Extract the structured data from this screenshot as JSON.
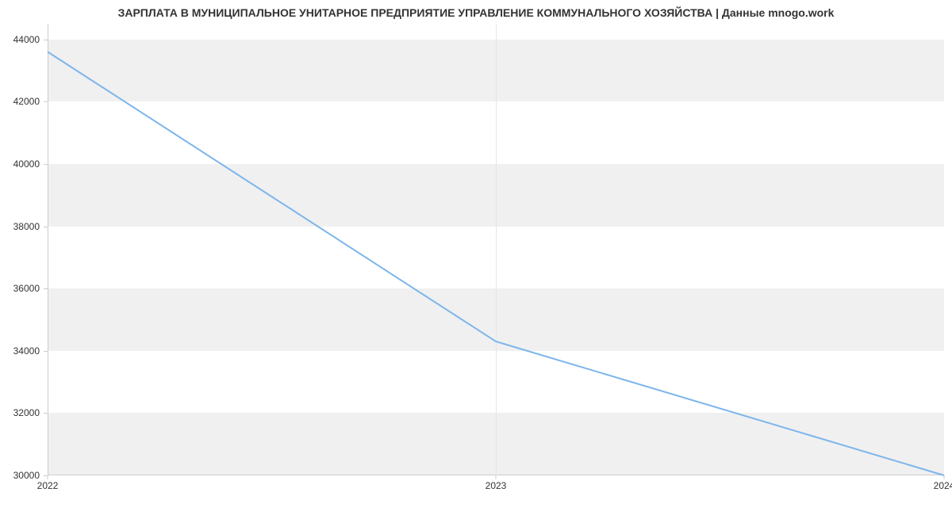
{
  "chart_data": {
    "type": "line",
    "title": "ЗАРПЛАТА В МУНИЦИПАЛЬНОЕ УНИТАРНОЕ ПРЕДПРИЯТИЕ УПРАВЛЕНИЕ КОММУНАЛЬНОГО ХОЗЯЙСТВА | Данные mnogo.work",
    "x": [
      2022,
      2023,
      2024
    ],
    "values": [
      43600,
      34300,
      30000
    ],
    "x_ticks": [
      2022,
      2023,
      2024
    ],
    "y_ticks": [
      30000,
      32000,
      34000,
      36000,
      38000,
      40000,
      42000,
      44000
    ],
    "xlim": [
      2022,
      2024
    ],
    "ylim": [
      30000,
      44500
    ],
    "bands": [
      [
        30000,
        32000
      ],
      [
        34000,
        36000
      ],
      [
        38000,
        40000
      ],
      [
        42000,
        44000
      ]
    ],
    "line_color": "#7cb5ec",
    "grid_band_color": "#f0f0f0"
  }
}
